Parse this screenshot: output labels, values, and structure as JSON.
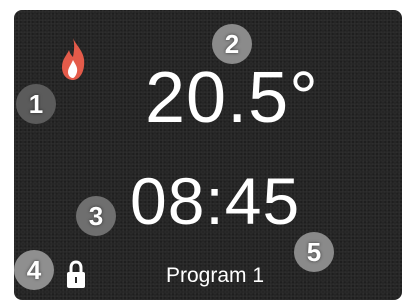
{
  "display": {
    "temperature": "20.5°",
    "time": "08:45",
    "program": "Program 1"
  },
  "icons": {
    "heating": "flame-icon",
    "lock": "lock-icon"
  },
  "callouts": [
    "1",
    "2",
    "3",
    "4",
    "5"
  ],
  "colors": {
    "screen_background": "#262626",
    "text": "#ffffff",
    "flame_outer": "#e45b4a",
    "flame_inner": "#ffffff"
  }
}
